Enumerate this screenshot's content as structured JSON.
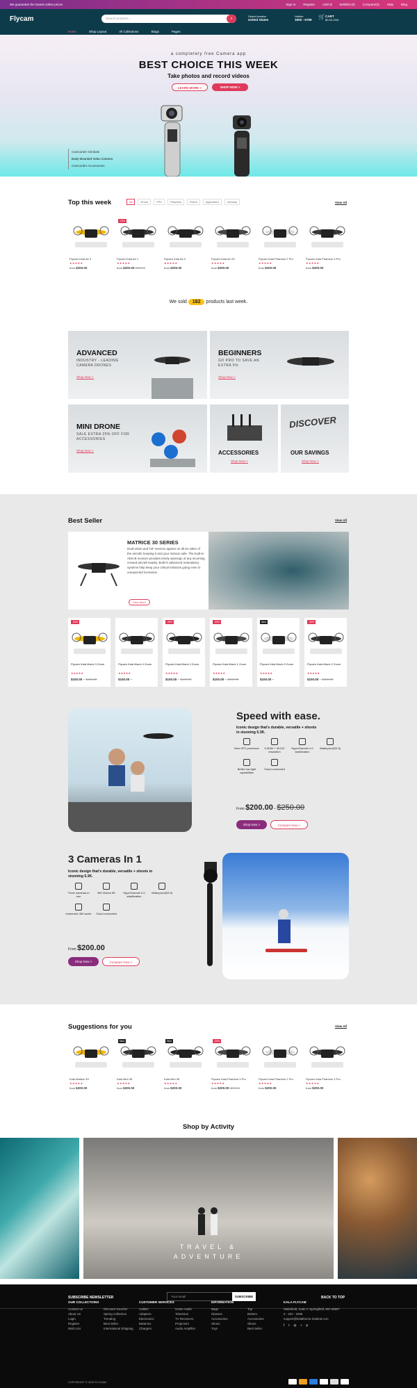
{
  "topbar": {
    "promo": "We guarantee the lowest online prices",
    "links": [
      "Sign In",
      "Register",
      "USD $",
      "Wishlist (0)",
      "Compare(0)",
      "Help",
      "Blog"
    ]
  },
  "header": {
    "logo": "Flycam",
    "search_placeholder": "Search products ...",
    "location_label": "Select location",
    "location_value": "United States",
    "hotline_label": "Hotline",
    "hotline_value": "1900 - 6789",
    "cart_label": "CART",
    "cart_value": "$0.00 USD"
  },
  "nav": [
    "Home",
    "Shop Layout",
    "All Collections",
    "Blogs",
    "Pages"
  ],
  "hero": {
    "small": "a completely free Camera app",
    "title": "BEST CHOICE THIS WEEK",
    "subtitle": "Take photos and record videos",
    "btn_learn": "LEARN MORE >",
    "btn_shop": "SHOP NOW >",
    "list": [
      "Camcorder Gimbals",
      "Body Mounted Video Camera",
      "Camcorder Accessories"
    ]
  },
  "top_week": {
    "title": "Top this week",
    "view_all": "View All",
    "tabs": [
      "All",
      "Drone",
      "FPV",
      "Phantom",
      "Robot",
      "Agriculture",
      "Industry"
    ],
    "products": [
      {
        "name": "Flycam Kala Air 3",
        "price": "$200.00",
        "old": "",
        "badge": ""
      },
      {
        "name": "Flycam Kala Air 1",
        "price": "$200.00",
        "old": "$250.00",
        "badge": "-20%"
      },
      {
        "name": "Flycam Kala Air 0",
        "price": "$200.00",
        "old": "",
        "badge": ""
      },
      {
        "name": "Flycam Kala Air 2S",
        "price": "$200.00",
        "old": "",
        "badge": ""
      },
      {
        "name": "Flycam Kala Phantom 2 Pro",
        "price": "$200.00",
        "old": "",
        "badge": ""
      },
      {
        "name": "Flycam Kala Phantom 3 Pro",
        "price": "$200.00",
        "old": "",
        "badge": ""
      }
    ]
  },
  "sold": {
    "before": "We sold",
    "count": "182",
    "after": "products last week."
  },
  "banners": {
    "advanced": {
      "title": "ADVANCED",
      "text": "INDUSTRY - LEADING CAMERA DRONES",
      "shop": "Shop Now >"
    },
    "beginners": {
      "title": "BEGINNERS",
      "text": "GO PRO TO SAVE AN EXTRA 5%",
      "shop": "Shop Now >"
    },
    "mini": {
      "title": "MINI DRONE",
      "text": "SALE EXTRA 25% OFF FOR ACCESSORIES",
      "shop": "Shop Now >"
    },
    "accessories": {
      "title": "ACCESSORIES",
      "shop": "Shop Now >"
    },
    "savings": {
      "title": "OUR SAVINGS",
      "logo_text": "DISCOVER",
      "shop": "Shop Now >"
    }
  },
  "best_seller": {
    "title": "Best Seller",
    "view_all": "View All",
    "feature": {
      "title": "MATRICE 30 SERIES",
      "text": "Dual-vision and ToF sensors appear on all six sides of the aircraft, keeping it and your mission safe. The built-in ADS-B receiver provides timely warnings of any incoming crewed aircraft nearby. Built-in advanced redundancy systems help keep your critical missions going even in unexpected scenarios.",
      "btn": "View More"
    },
    "products": [
      {
        "name": "Flycam Kala Mavic 3 Zoom",
        "price": "$100.00",
        "old": "$150.00",
        "badge": "-33%"
      },
      {
        "name": "Flycam Kala Mavic 4 Zoom",
        "price": "$100.00",
        "old": "",
        "badge": ""
      },
      {
        "name": "Flycam Kala Mavic 3 Zoom",
        "price": "$100.00",
        "old": "$150.00",
        "badge": "-33%"
      },
      {
        "name": "Flycam Kala Mavic 1 Zoom",
        "price": "$100.00",
        "old": "$150.00",
        "badge": "-33%"
      },
      {
        "name": "Flycam Kala Mavic 5 Zoom",
        "price": "$100.00",
        "old": "",
        "badge": "New"
      },
      {
        "name": "Flycam Kala Mavic 2 Zoom",
        "price": "$100.00",
        "old": "$150.00",
        "badge": "-33%"
      }
    ]
  },
  "speed": {
    "title": "Speed with ease.",
    "desc": "Iconic design that's durable, versatile + shoots in stunning 5.3K.",
    "features": [
      "New GP2 processor",
      "5.3K60 + 4K120 resolution",
      "HyperSmooth 4.0 stabilization",
      "Waterproof(33 ft)",
      "Better low-light capabilities",
      "Cloud connected"
    ],
    "from": "From",
    "price": "$200.00",
    "old": "$250.00",
    "shop": "Shop Now >",
    "compare": "Compare Now >"
  },
  "cameras": {
    "title": "3 Cameras In 1",
    "desc": "Iconic design that's durable, versatile + shoots in stunning 5.3K.",
    "features": [
      "Three cameras in one",
      "360 Videos 5K",
      "HyperSmooth 4.0 stabilization",
      "Waterproof(33 ft)",
      "Immersive 360 audio",
      "Cloud connected"
    ],
    "from": "From",
    "price": "$200.00",
    "shop": "Shop Now >",
    "compare": "Compare Now >"
  },
  "suggestions": {
    "title": "Suggestions for you",
    "view_all": "View All",
    "products": [
      {
        "name": "Kala Mattice 3S",
        "price": "$200.00",
        "old": "",
        "badge": ""
      },
      {
        "name": "Kala Mini 3E",
        "price": "$200.00",
        "old": "",
        "badge": "New"
      },
      {
        "name": "Kala Mini 3E",
        "price": "$200.00",
        "old": "",
        "badge": "New"
      },
      {
        "name": "Flycam Kala Phantom 3 Pro",
        "price": "$200.00",
        "old": "$250.00",
        "badge": "-20%"
      },
      {
        "name": "Flycam Kala Phantom 2 Pro",
        "price": "$200.00",
        "old": "",
        "badge": ""
      },
      {
        "name": "Flycam Kala Phantom 3 Pro",
        "price": "$200.00",
        "old": "",
        "badge": ""
      }
    ]
  },
  "activity": {
    "title": "Shop by Activity",
    "caption": "TRAVEL & ADVENTURE"
  },
  "footer": {
    "newsletter": "SUBSCRIBE NEWSLETTER",
    "email_placeholder": "Your email",
    "subscribe": "SUBSCRIBE",
    "back_top": "BACK TO TOP",
    "col1": {
      "title": "OUR COLLECTIONS",
      "items": [
        "Contact us",
        "About Us",
        "Login",
        "Register",
        "Wish List"
      ]
    },
    "col1b": {
      "items": [
        "Discount Voucher",
        "Spring Collection",
        "Trending",
        "Best Seller",
        "International Shipping"
      ]
    },
    "col2": {
      "title": "CUSTOMER SERVICES",
      "items": [
        "Cables",
        "Adapters",
        "Electronics",
        "Batteries",
        "Chargers"
      ]
    },
    "col2b": {
      "items": [
        "Home Audio",
        "Television",
        "TV Receivers",
        "Projectors",
        "Audio Amplifier"
      ]
    },
    "col3": {
      "title": "INFORMATION",
      "items": [
        "Bags",
        "Glasses",
        "Accessories",
        "Shoes",
        "Toys"
      ]
    },
    "col3b": {
      "items": [
        "Top",
        "Bottom",
        "Accessories",
        "Shoes",
        "Best Seller"
      ]
    },
    "col4": {
      "title": "KALA FLYCAM",
      "address": "Wakefield, Suite C Springfield, MO 65807",
      "phone": "0 - 222 - 3456",
      "email": "support@kalatheme.hotdeal.com"
    },
    "copyright": "COPYRIGHT © 2022 FLYCAM"
  }
}
